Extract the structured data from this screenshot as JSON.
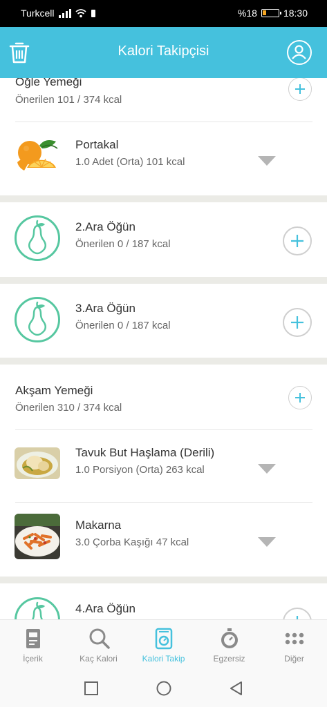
{
  "status_bar": {
    "carrier": "Turkcell",
    "battery_text": "%18",
    "time": "18:30",
    "battery_level": 0.18
  },
  "header": {
    "title": "Kalori Takipçisi",
    "trash_icon": "trash-icon",
    "profile_icon": "user-icon",
    "color": "#45c1dd"
  },
  "meals": {
    "lunch": {
      "title": "Öğle Yemeği",
      "subtitle": "Önerilen 101 / 374 kcal",
      "foods": [
        {
          "name": "Portakal",
          "detail": "1.0 Adet (Orta) 101 kcal",
          "image": "orange"
        }
      ]
    },
    "snack2": {
      "title": "2.Ara Öğün",
      "subtitle": "Önerilen 0 / 187 kcal",
      "icon": "pear-icon"
    },
    "snack3": {
      "title": "3.Ara Öğün",
      "subtitle": "Önerilen 0 / 187 kcal",
      "icon": "pear-icon"
    },
    "dinner": {
      "title": "Akşam Yemeği",
      "subtitle": "Önerilen 310 / 374 kcal",
      "foods": [
        {
          "name": "Tavuk But Haşlama (Derili)",
          "detail": "1.0 Porsiyon (Orta) 263 kcal",
          "image": "chicken"
        },
        {
          "name": "Makarna",
          "detail": "3.0 Çorba Kaşığı 47 kcal",
          "image": "pasta"
        }
      ]
    },
    "snack4": {
      "title": "4.Ara Öğün",
      "icon": "pear-icon"
    }
  },
  "bottom_nav": {
    "items": [
      {
        "label": "İçerik",
        "icon": "book-icon"
      },
      {
        "label": "Kaç Kalori",
        "icon": "search-icon"
      },
      {
        "label": "Kalori Takip",
        "icon": "scale-icon",
        "active": true
      },
      {
        "label": "Egzersiz",
        "icon": "stopwatch-icon"
      },
      {
        "label": "Diğer",
        "icon": "more-dots-icon"
      }
    ],
    "active_color": "#45c1dd"
  },
  "system_nav": {
    "recents": "square-icon",
    "home": "circle-icon",
    "back": "triangle-back-icon"
  },
  "colors": {
    "accent": "#45c1dd",
    "snack_green": "#56c7a0",
    "separator": "#ebebe6"
  }
}
